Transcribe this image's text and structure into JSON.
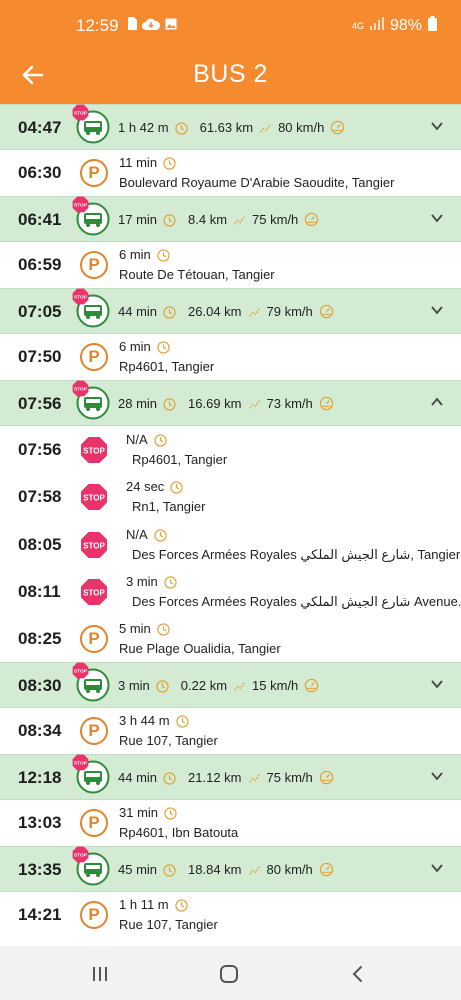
{
  "status_bar": {
    "time": "12:59",
    "network": "4G",
    "battery": "98%",
    "icons": [
      "sim-icon",
      "cloud-icon",
      "image-icon",
      "signal-icon",
      "battery-icon"
    ]
  },
  "app_bar": {
    "title": "BUS 2",
    "back_icon": "arrow-left-icon",
    "bg_color": "#f58a2f"
  },
  "colors": {
    "travel_row_bg": "#d3ebd3",
    "park_icon": "#e0852e",
    "stop_icon": "#e8336b",
    "bus_icon": "#2e8b3a"
  },
  "items": [
    {
      "kind": "travel",
      "time": "04:47",
      "duration": "1 h 42 m",
      "distance": "61.63 km",
      "speed": "80 km/h",
      "expanded": false
    },
    {
      "kind": "park",
      "time": "06:30",
      "duration": "11 min",
      "address": "Boulevard Royaume D'Arabie Saoudite, Tangier"
    },
    {
      "kind": "travel",
      "time": "06:41",
      "duration": "17 min",
      "distance": "8.4 km",
      "speed": "75 km/h",
      "expanded": false
    },
    {
      "kind": "park",
      "time": "06:59",
      "duration": "6 min",
      "address": "Route De Tétouan, Tangier"
    },
    {
      "kind": "travel",
      "time": "07:05",
      "duration": "44 min",
      "distance": "26.04 km",
      "speed": "79 km/h",
      "expanded": false
    },
    {
      "kind": "park",
      "time": "07:50",
      "duration": "6 min",
      "address": "Rp4601, Tangier"
    },
    {
      "kind": "travel",
      "time": "07:56",
      "duration": "28 min",
      "distance": "16.69 km",
      "speed": "73 km/h",
      "expanded": true
    },
    {
      "kind": "stop",
      "time": "07:56",
      "duration": "N/A",
      "address": "Rp4601, Tangier"
    },
    {
      "kind": "stop",
      "time": "07:58",
      "duration": "24 sec",
      "address": "Rn1, Tangier"
    },
    {
      "kind": "stop",
      "time": "08:05",
      "duration": "N/A",
      "address": "Des Forces Armées Royales شارع الجيش الملكي, Tangier"
    },
    {
      "kind": "stop",
      "time": "08:11",
      "duration": "3 min",
      "address": "Des Forces Armées Royales شارع الجيش الملكي Avenue..."
    },
    {
      "kind": "park",
      "time": "08:25",
      "duration": "5 min",
      "address": "Rue Plage Oualidia, Tangier"
    },
    {
      "kind": "travel",
      "time": "08:30",
      "duration": "3 min",
      "distance": "0.22 km",
      "speed": "15 km/h",
      "expanded": false
    },
    {
      "kind": "park",
      "time": "08:34",
      "duration": "3 h 44 m",
      "address": "Rue 107, Tangier"
    },
    {
      "kind": "travel",
      "time": "12:18",
      "duration": "44 min",
      "distance": "21.12 km",
      "speed": "75 km/h",
      "expanded": false
    },
    {
      "kind": "park",
      "time": "13:03",
      "duration": "31 min",
      "address": "Rp4601, Ibn Batouta"
    },
    {
      "kind": "travel",
      "time": "13:35",
      "duration": "45 min",
      "distance": "18.84 km",
      "speed": "80 km/h",
      "expanded": false
    },
    {
      "kind": "park",
      "time": "14:21",
      "duration": "1 h 11 m",
      "address": "Rue 107, Tangier"
    }
  ],
  "nav_bar": {
    "icons": [
      "recent-apps-icon",
      "home-icon",
      "back-nav-icon"
    ]
  }
}
